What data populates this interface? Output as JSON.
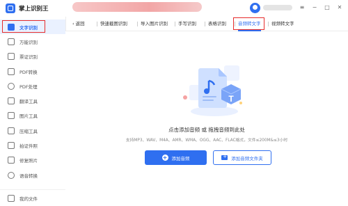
{
  "app": {
    "title": "掌上识别王"
  },
  "sidebar": {
    "items": [
      {
        "label": "文字识别",
        "icon": "text-recognition-icon",
        "active": true
      },
      {
        "label": "万能识别",
        "icon": "camera-icon"
      },
      {
        "label": "票证识别",
        "icon": "ticket-icon"
      },
      {
        "label": "PDF转换",
        "icon": "pdf-convert-icon"
      },
      {
        "label": "PDF处理",
        "icon": "pdf-process-icon"
      },
      {
        "label": "翻译工具",
        "icon": "translate-icon"
      },
      {
        "label": "图片工具",
        "icon": "image-icon"
      },
      {
        "label": "压缩工具",
        "icon": "compress-icon"
      },
      {
        "label": "拍证件照",
        "icon": "id-photo-icon"
      },
      {
        "label": "修复照片",
        "icon": "repair-photo-icon"
      },
      {
        "label": "语音转换",
        "icon": "voice-icon"
      }
    ],
    "bottom": {
      "label": "我的文件",
      "icon": "files-icon"
    }
  },
  "tabs": {
    "back_label": "返回",
    "items": [
      {
        "label": "快速截图识别"
      },
      {
        "label": "导入图片识别"
      },
      {
        "label": "手写识别"
      },
      {
        "label": "表格识别"
      },
      {
        "label": "音频转文字",
        "active": true
      },
      {
        "label": "视频转文字"
      }
    ]
  },
  "window": {
    "minimize": "−",
    "maximize": "□",
    "close": "✕",
    "menu": "≡"
  },
  "main": {
    "hint": "点击添加音频 或 拖拽音频到此处",
    "formats": "支持MP3、WAV、M4A、AMR、WMA、OGG、AAC、FLAC格式，文件≤200M&≤3小时",
    "add_audio_button": "添加音频",
    "add_folder_button": "添加音频文件夹"
  },
  "colors": {
    "accent": "#2f6ff0",
    "highlight_box": "#e62b2b"
  }
}
